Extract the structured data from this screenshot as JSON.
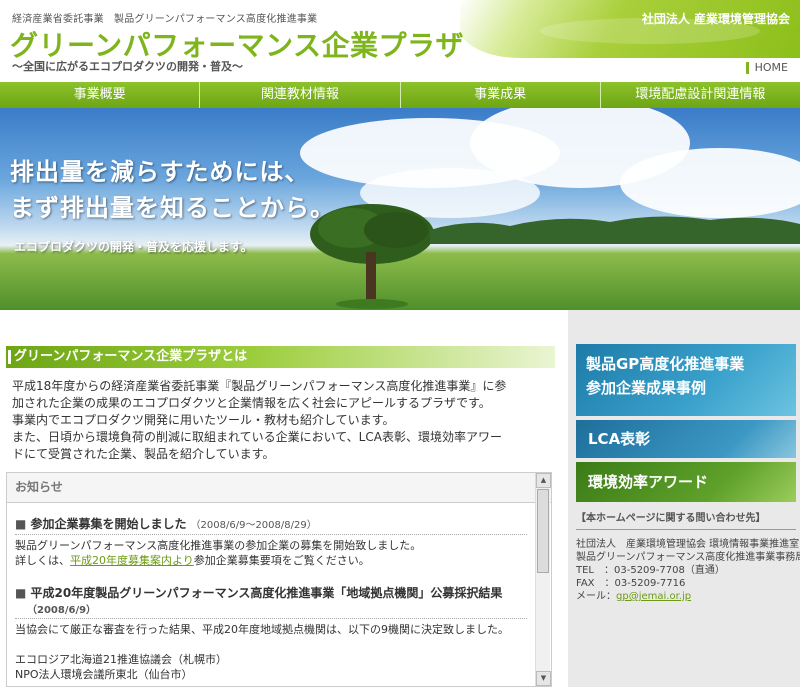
{
  "header": {
    "supertitle": "経済産業省委託事業　製品グリーンパフォーマンス高度化推進事業",
    "title": "グリーンパフォーマンス企業プラザ",
    "subtitle": "～全国に広がるエコプロダクツの開発・普及～",
    "org": "社団法人 産業環境管理協会",
    "home": "HOME"
  },
  "nav": [
    {
      "label": "事業概要"
    },
    {
      "label": "関連教材情報"
    },
    {
      "label": "事業成果"
    },
    {
      "label": "環境配慮設計関連情報"
    }
  ],
  "hero": {
    "line1": "排出量を減らすためには、",
    "line2": "まず排出量を知ることから。",
    "small": "エコプロダクツの開発・普及を応援します。"
  },
  "main": {
    "section_title": "グリーンパフォーマンス企業プラザとは",
    "intro": [
      "平成18年度からの経済産業省委託事業『製品グリーンパフォーマンス高度化推進事業』に参",
      "加された企業の成果のエコプロダクツと企業情報を広く社会にアピールするプラザです。",
      "事業内でエコプロダクツ開発に用いたツール・教材も紹介しています。",
      "また、日頃から環境負荷の削減に取組まれている企業において、LCA表彰、環境効率アワー",
      "ドにて受賞された企業、製品を紹介しています。"
    ]
  },
  "news": {
    "header": "お知らせ",
    "items": [
      {
        "title": "参加企業募集を開始しました",
        "date": "（2008/6/9～2008/8/29）",
        "body1": "製品グリーンパフォーマンス高度化推進事業の参加企業の募集を開始致しました。",
        "body2_pre": "詳しくは、",
        "body2_link": "平成20年度募集案内より",
        "body2_post": "参加企業募集要項をご覧ください。"
      },
      {
        "title": "平成20年度製品グリーンパフォーマンス高度化推進事業「地域拠点機関」公募採択結果",
        "date": "（2008/6/9）",
        "body1": "当協会にて厳正な審査を行った結果、平成20年度地域拠点機関は、以下の9機関に決定致しました。",
        "org1": "エコロジア北海道21推進協議会（札幌市）",
        "org2": "NPO法人環境会議所東北（仙台市）"
      }
    ]
  },
  "sidebar": {
    "banner_gp_line1": "製品GP高度化推進事業",
    "banner_gp_line2": "参加企業成果事例",
    "banner_lca": "LCA表彰",
    "banner_award": "環境効率アワード",
    "contact_head": "【本ホームページに関する問い合わせ先】",
    "contact_org1": "社団法人　産業環境管理協会 環境情報事業推進室",
    "contact_org2": "製品グリーンパフォーマンス高度化推進事業事務局",
    "tel_label": "TEL　：",
    "tel": "03-5209-7708（直通）",
    "fax_label": "FAX　：",
    "fax": "03-5209-7716",
    "mail_label": "メール：",
    "mail": "gp@jemai.or.jp"
  },
  "colors": {
    "brand_green": "#7fb51c",
    "nav_green": "#6da515",
    "link_green": "#6b9b13",
    "banner_blue": "#1d7ba8",
    "banner_green": "#3b7b17"
  }
}
